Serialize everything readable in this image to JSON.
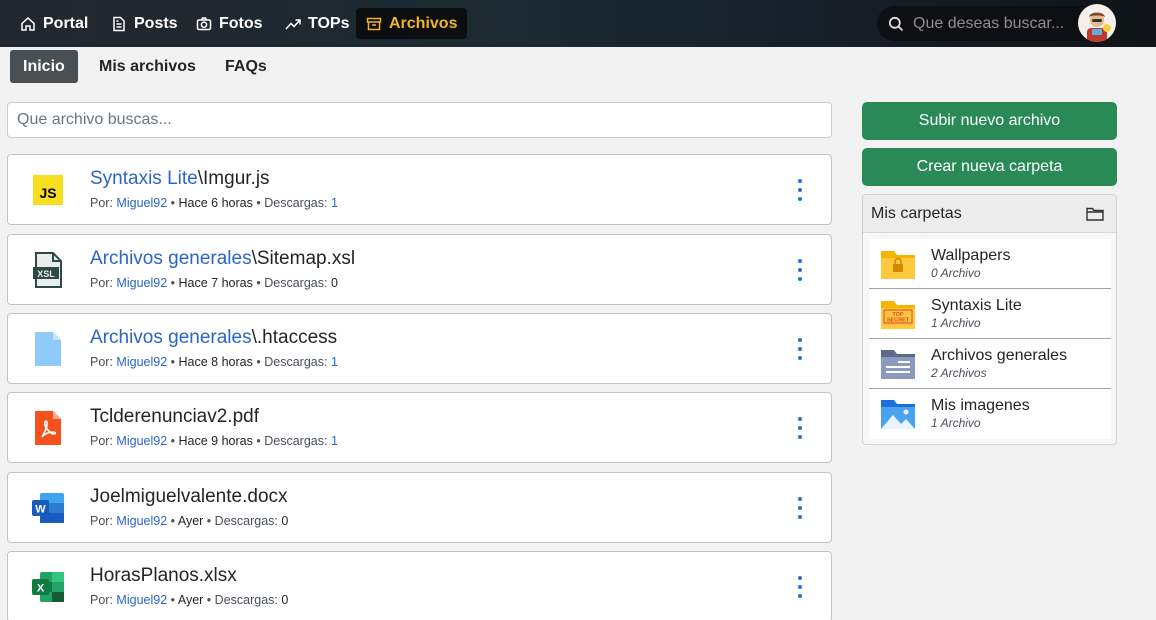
{
  "nav": {
    "items": [
      {
        "label": "Portal",
        "icon": "home-icon"
      },
      {
        "label": "Posts",
        "icon": "document-icon"
      },
      {
        "label": "Fotos",
        "icon": "camera-icon"
      },
      {
        "label": "TOPs",
        "icon": "trending-icon"
      },
      {
        "label": "Archivos",
        "icon": "archive-icon",
        "active": true
      }
    ],
    "search_placeholder": "Que deseas buscar...",
    "active_color": "#f0b429"
  },
  "subnav": {
    "tabs": [
      {
        "label": "Inicio",
        "active": true
      },
      {
        "label": "Mis archivos"
      },
      {
        "label": "FAQs"
      }
    ]
  },
  "files": {
    "search_placeholder": "Que archivo buscas...",
    "meta_labels": {
      "by": "Por:",
      "downloads": "Descargas:",
      "sep": "•"
    },
    "items": [
      {
        "folder": "Syntaxis Lite",
        "sep": "\\",
        "name": "Imgur.js",
        "user": "Miguel92",
        "time": "Hace 6 horas",
        "downloads": "1",
        "icon": "js-file-icon"
      },
      {
        "folder": "Archivos generales",
        "sep": "\\",
        "name": "Sitemap.xsl",
        "user": "Miguel92",
        "time": "Hace 7 horas",
        "downloads": "0",
        "icon": "xsl-file-icon"
      },
      {
        "folder": "Archivos generales",
        "sep": "\\",
        "name": ".htaccess",
        "user": "Miguel92",
        "time": "Hace 8 horas",
        "downloads": "1",
        "icon": "generic-file-icon"
      },
      {
        "folder": "",
        "sep": "",
        "name": "Tclderenunciav2.pdf",
        "user": "Miguel92",
        "time": "Hace 9 horas",
        "downloads": "1",
        "icon": "pdf-file-icon"
      },
      {
        "folder": "",
        "sep": "",
        "name": "Joelmiguelvalente.docx",
        "user": "Miguel92",
        "time": "Ayer",
        "downloads": "0",
        "icon": "word-file-icon"
      },
      {
        "folder": "",
        "sep": "",
        "name": "HorasPlanos.xlsx",
        "user": "Miguel92",
        "time": "Ayer",
        "downloads": "0",
        "icon": "excel-file-icon"
      }
    ]
  },
  "sidebar": {
    "upload_label": "Subir nuevo archivo",
    "new_folder_label": "Crear nueva carpeta",
    "folders_title": "Mis carpetas",
    "folders": [
      {
        "name": "Wallpapers",
        "count": "0 Archivo",
        "icon": "locked-folder-icon"
      },
      {
        "name": "Syntaxis Lite",
        "count": "1 Archivo",
        "icon": "top-secret-folder-icon"
      },
      {
        "name": "Archivos generales",
        "count": "2 Archivos",
        "icon": "documents-folder-icon"
      },
      {
        "name": "Mis imagenes",
        "count": "1 Archivo",
        "icon": "pictures-folder-icon"
      }
    ],
    "button_color": "#2a8a57"
  }
}
